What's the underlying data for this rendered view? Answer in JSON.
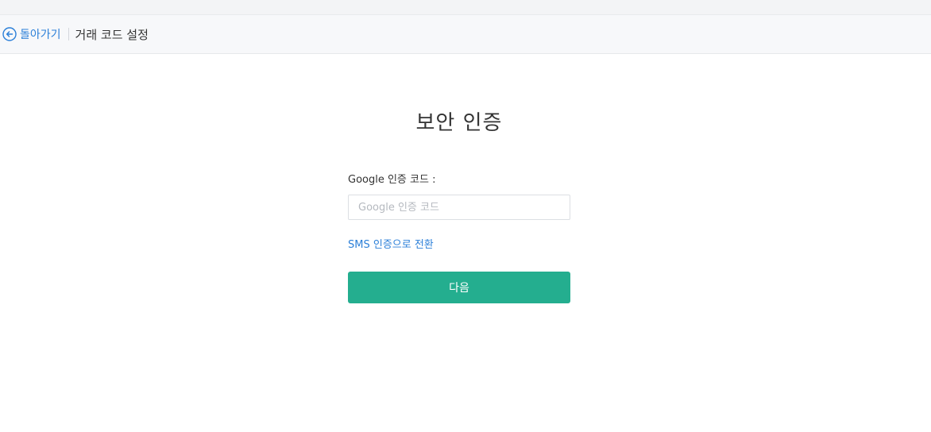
{
  "header": {
    "back_label": "돌아가기",
    "title": "거래 코드 설정"
  },
  "main": {
    "title": "보안 인증",
    "google_code_label": "Google 인증 코드 :",
    "google_code_placeholder": "Google 인증 코드",
    "google_code_value": "",
    "switch_sms_label": "SMS 인증으로 전환",
    "next_button_label": "다음"
  },
  "colors": {
    "accent": "#2b7fd8",
    "primary_button": "#24ae8f"
  },
  "icons": {
    "back": "arrow-left-circle-icon"
  }
}
